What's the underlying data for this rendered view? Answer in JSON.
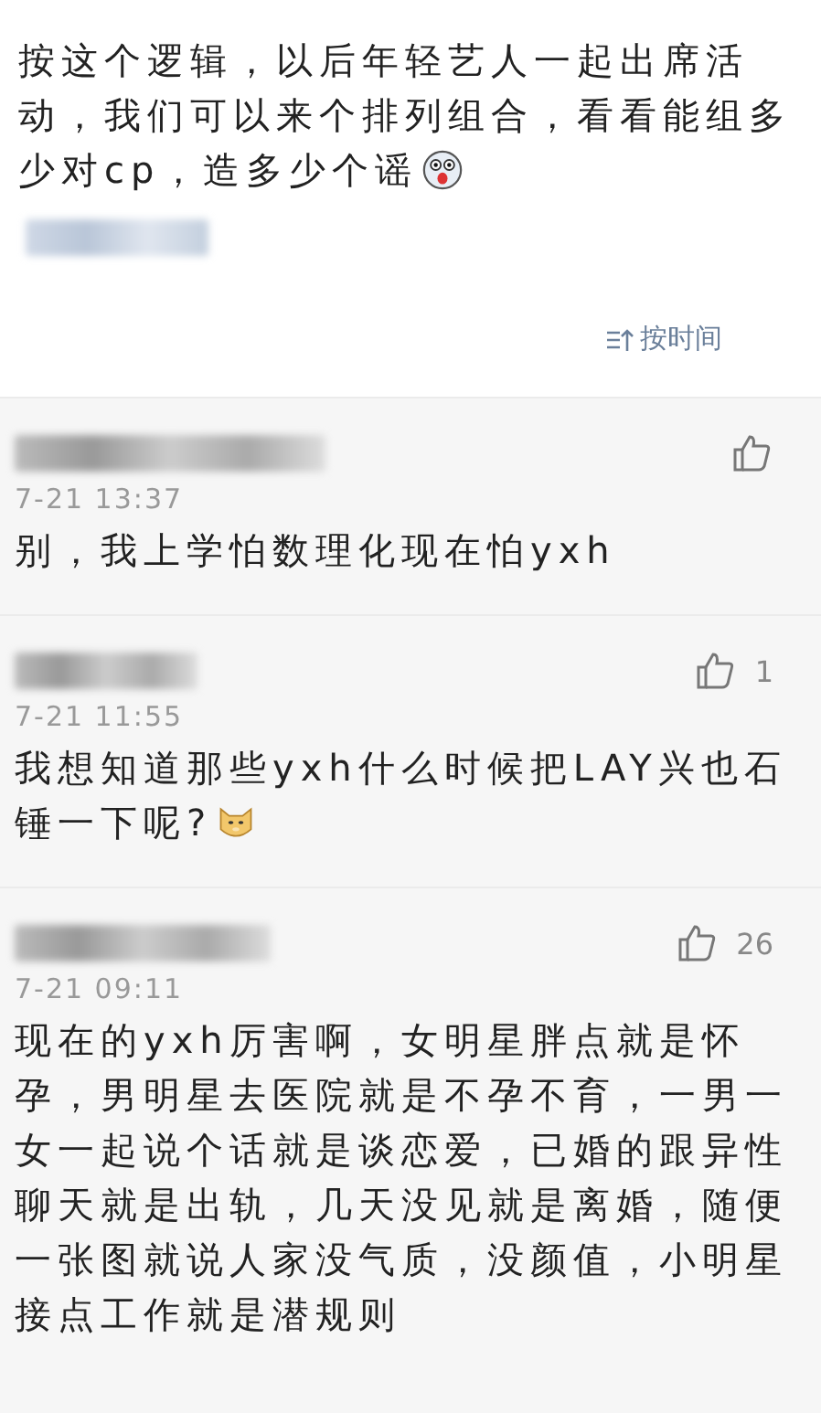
{
  "post": {
    "text": "按这个逻辑，以后年轻艺人一起出席活动，我们可以来个排列组合，看看能组多少对cp，造多少个谣",
    "emoji": {
      "kind": "shocked"
    }
  },
  "sort_button": {
    "label": "按时间"
  },
  "comments": [
    {
      "time": "7-21 13:37",
      "text": "别，我上学怕数理化现在怕yxh"
    },
    {
      "time": "7-21 11:55",
      "likes": "1",
      "text": "我想知道那些yxh什么时候把LAY兴也石锤一下呢?",
      "emoji": {
        "kind": "doge"
      }
    },
    {
      "time": "7-21 09:11",
      "likes": "26",
      "text": "现在的yxh厉害啊，女明星胖点就是怀孕，男明星去医院就是不孕不育，一男一女一起说个话就是谈恋爱，已婚的跟异性聊天就是出轨，几天没见就是离婚，随便一张图就说人家没气质，没颜值，小明星接点工作就是潜规则"
    }
  ]
}
